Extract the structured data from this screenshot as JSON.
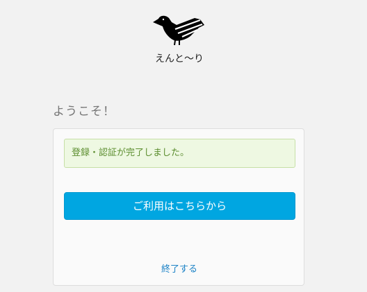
{
  "header": {
    "logo_icon": "bird-logo-icon",
    "brand_name": "えんと〜り"
  },
  "welcome": {
    "title": "ようこそ！"
  },
  "card": {
    "alert_message": "登録・認証が完了しました。",
    "primary_button_label": "ご利用はこちらから",
    "exit_link_label": "終了する"
  },
  "colors": {
    "background": "#f2f2f2",
    "accent": "#00a6e1",
    "success_text": "#5b8d2e",
    "success_bg": "#eef8e2",
    "link": "#1b82c6"
  }
}
